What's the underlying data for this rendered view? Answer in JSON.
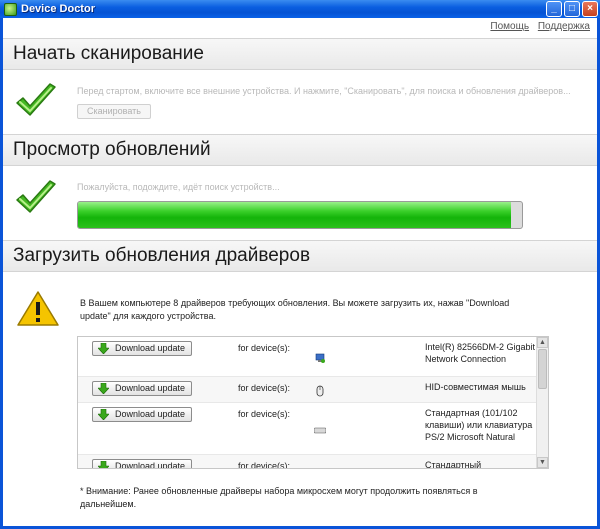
{
  "window": {
    "title": "Device Doctor",
    "minimize_label": "_",
    "maximize_label": "□",
    "close_label": "×"
  },
  "toplinks": {
    "help": "Помощь",
    "support": "Поддержка"
  },
  "scan_section": {
    "title": "Начать сканирование",
    "description": "Перед стартом, включите все внешние устройства. И нажмите, \"Сканировать\", для поиска и обновления драйверов...",
    "button_label": "Сканировать"
  },
  "review_section": {
    "title": "Просмотр обновлений",
    "status": "Пожалуйста, подождите, идёт поиск устройств...",
    "progress": 1.0
  },
  "download_section": {
    "title": "Загрузить обновления драйверов",
    "info": "В Вашем компьютере 8 драйверов требующих обновления. Вы можете загрузить их, нажав \"Download update\" для каждого устройства.",
    "footnote": "* Внимание: Ранее обновленные драйверы набора микросхем могут продолжить появляться в дальнейшем."
  },
  "devices": [
    {
      "button": "Download update",
      "for": "for device(s):",
      "icon": "network-icon",
      "name": "Intel(R) 82566DM-2 Gigabit Network Connection"
    },
    {
      "button": "Download update",
      "for": "for device(s):",
      "icon": "mouse-icon",
      "name": "HID-совместимая мышь"
    },
    {
      "button": "Download update",
      "for": "for device(s):",
      "icon": "keyboard-icon",
      "name": "Стандартная (101/102 клавиши) или клавиатура PS/2 Microsoft Natural"
    },
    {
      "button": "Download update",
      "for": "for device(s):",
      "icon": "device-icon",
      "name": "Стандартный"
    }
  ],
  "colors": {
    "titlebar": "#0553d4",
    "progress": "#14b40a",
    "check": "#3ab21c"
  }
}
